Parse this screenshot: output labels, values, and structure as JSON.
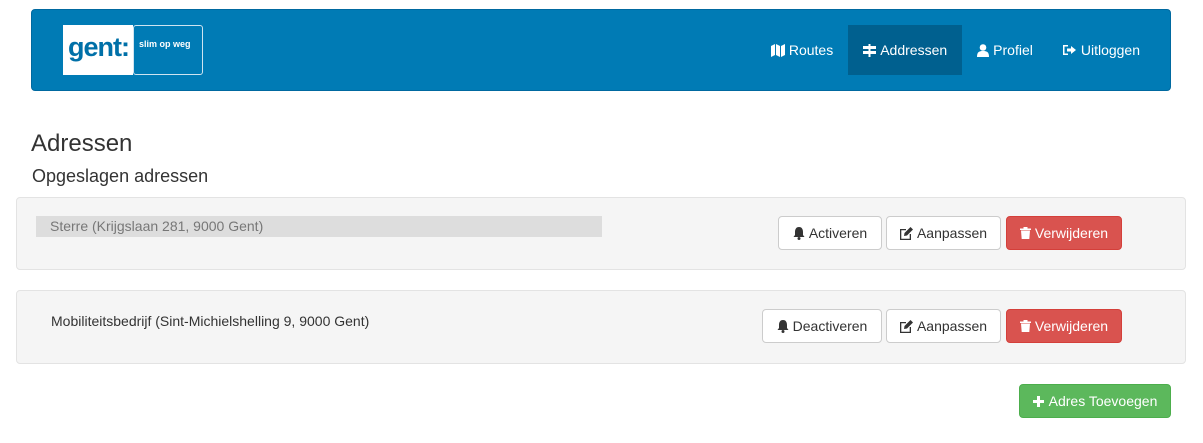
{
  "logo": {
    "brand": "gent:",
    "tagline": "slim op weg"
  },
  "nav": {
    "items": [
      {
        "label": "Routes",
        "icon": "map-icon",
        "active": false
      },
      {
        "label": "Addressen",
        "icon": "signpost-icon",
        "active": true
      },
      {
        "label": "Profiel",
        "icon": "user-icon",
        "active": false
      },
      {
        "label": "Uitloggen",
        "icon": "logout-icon",
        "active": false
      }
    ]
  },
  "page": {
    "title": "Adressen",
    "section_title": "Opgeslagen adressen"
  },
  "addresses": [
    {
      "text": "Sterre (Krijgslaan 281, 9000 Gent)",
      "status": "inactive",
      "toggle_label": "Activeren",
      "edit_label": "Aanpassen",
      "delete_label": "Verwijderen"
    },
    {
      "text": "Mobiliteitsbedrijf (Sint-Michielshelling 9, 9000 Gent)",
      "status": "active",
      "toggle_label": "Deactiveren",
      "edit_label": "Aanpassen",
      "delete_label": "Verwijderen"
    }
  ],
  "add_button_label": "Adres Toevoegen",
  "colors": {
    "navbar": "#007bb5",
    "nav_active": "#00608f",
    "danger": "#d9534f",
    "success": "#5cb85c"
  }
}
